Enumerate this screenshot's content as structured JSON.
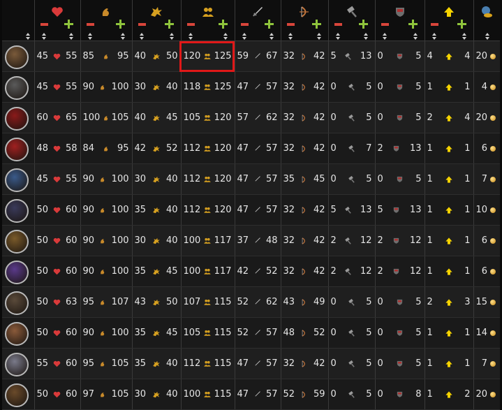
{
  "columns": [
    {
      "key": "portrait",
      "icon": "warrior-portrait-icon"
    },
    {
      "key": "health",
      "icon": "heart-icon",
      "color": "#d93a3a"
    },
    {
      "key": "strength",
      "icon": "arm-icon",
      "color": "#c98a2a"
    },
    {
      "key": "agility",
      "icon": "dragon-icon",
      "color": "#d6a020"
    },
    {
      "key": "leadership",
      "icon": "people-icon",
      "color": "#d6a020"
    },
    {
      "key": "melee",
      "icon": "sword-icon",
      "color": "#bdbdbd"
    },
    {
      "key": "ranged",
      "icon": "bow-icon",
      "color": "#c0733a"
    },
    {
      "key": "armor",
      "icon": "hammer-icon",
      "color": "#9a9a9a"
    },
    {
      "key": "shield",
      "icon": "shield-icon",
      "color": "#b03030"
    },
    {
      "key": "level",
      "icon": "arrow-up-icon",
      "color": "#f5d300"
    },
    {
      "key": "gold",
      "icon": "gold-globe-icon",
      "color": "#d9a21b"
    }
  ],
  "rows": [
    {
      "portrait": "hand-icon",
      "cells": [
        [
          "45",
          "55"
        ],
        [
          "85",
          "95"
        ],
        [
          "40",
          "50"
        ],
        [
          "120",
          "125"
        ],
        [
          "59",
          "67"
        ],
        [
          "32",
          "42"
        ],
        [
          "5",
          "13"
        ],
        [
          "0",
          "5"
        ],
        [
          "4",
          "4"
        ]
      ],
      "gold": "20"
    },
    {
      "portrait": "gauntlet-icon",
      "cells": [
        [
          "45",
          "55"
        ],
        [
          "90",
          "100"
        ],
        [
          "30",
          "40"
        ],
        [
          "118",
          "125"
        ],
        [
          "47",
          "57"
        ],
        [
          "32",
          "42"
        ],
        [
          "0",
          "5"
        ],
        [
          "0",
          "5"
        ],
        [
          "1",
          "1"
        ]
      ],
      "gold": "4"
    },
    {
      "portrait": "red-dragon-icon",
      "cells": [
        [
          "60",
          "65"
        ],
        [
          "100",
          "105"
        ],
        [
          "40",
          "45"
        ],
        [
          "105",
          "120"
        ],
        [
          "57",
          "62"
        ],
        [
          "32",
          "42"
        ],
        [
          "0",
          "5"
        ],
        [
          "0",
          "5"
        ],
        [
          "2",
          "4"
        ]
      ],
      "gold": "20"
    },
    {
      "portrait": "dice-icon",
      "cells": [
        [
          "48",
          "58"
        ],
        [
          "84",
          "95"
        ],
        [
          "42",
          "52"
        ],
        [
          "112",
          "120"
        ],
        [
          "47",
          "57"
        ],
        [
          "32",
          "42"
        ],
        [
          "0",
          "7"
        ],
        [
          "2",
          "13"
        ],
        [
          "1",
          "1"
        ]
      ],
      "gold": "6"
    },
    {
      "portrait": "jester-icon",
      "cells": [
        [
          "45",
          "55"
        ],
        [
          "90",
          "100"
        ],
        [
          "30",
          "40"
        ],
        [
          "112",
          "120"
        ],
        [
          "47",
          "57"
        ],
        [
          "35",
          "45"
        ],
        [
          "0",
          "5"
        ],
        [
          "0",
          "5"
        ],
        [
          "1",
          "1"
        ]
      ],
      "gold": "7"
    },
    {
      "portrait": "mask-icon",
      "cells": [
        [
          "50",
          "60"
        ],
        [
          "90",
          "100"
        ],
        [
          "35",
          "40"
        ],
        [
          "112",
          "120"
        ],
        [
          "47",
          "57"
        ],
        [
          "32",
          "42"
        ],
        [
          "5",
          "13"
        ],
        [
          "5",
          "13"
        ],
        [
          "1",
          "1"
        ]
      ],
      "gold": "10"
    },
    {
      "portrait": "crossbow-icon",
      "cells": [
        [
          "50",
          "60"
        ],
        [
          "90",
          "100"
        ],
        [
          "30",
          "40"
        ],
        [
          "100",
          "117"
        ],
        [
          "37",
          "48"
        ],
        [
          "32",
          "42"
        ],
        [
          "2",
          "12"
        ],
        [
          "2",
          "12"
        ],
        [
          "1",
          "1"
        ]
      ],
      "gold": "6"
    },
    {
      "portrait": "purple-dragon-icon",
      "cells": [
        [
          "50",
          "60"
        ],
        [
          "90",
          "100"
        ],
        [
          "35",
          "45"
        ],
        [
          "100",
          "117"
        ],
        [
          "42",
          "52"
        ],
        [
          "32",
          "42"
        ],
        [
          "2",
          "12"
        ],
        [
          "2",
          "12"
        ],
        [
          "1",
          "1"
        ]
      ],
      "gold": "6"
    },
    {
      "portrait": "beast-icon",
      "cells": [
        [
          "50",
          "63"
        ],
        [
          "95",
          "107"
        ],
        [
          "43",
          "50"
        ],
        [
          "107",
          "115"
        ],
        [
          "52",
          "62"
        ],
        [
          "43",
          "49"
        ],
        [
          "0",
          "5"
        ],
        [
          "0",
          "5"
        ],
        [
          "2",
          "3"
        ]
      ],
      "gold": "15"
    },
    {
      "portrait": "fists-icon",
      "cells": [
        [
          "50",
          "60"
        ],
        [
          "90",
          "100"
        ],
        [
          "35",
          "45"
        ],
        [
          "105",
          "115"
        ],
        [
          "52",
          "57"
        ],
        [
          "48",
          "52"
        ],
        [
          "0",
          "5"
        ],
        [
          "0",
          "5"
        ],
        [
          "1",
          "1"
        ]
      ],
      "gold": "14"
    },
    {
      "portrait": "armored-hand-icon",
      "cells": [
        [
          "55",
          "60"
        ],
        [
          "95",
          "105"
        ],
        [
          "35",
          "40"
        ],
        [
          "112",
          "115"
        ],
        [
          "47",
          "57"
        ],
        [
          "32",
          "42"
        ],
        [
          "0",
          "5"
        ],
        [
          "0",
          "5"
        ],
        [
          "1",
          "1"
        ]
      ],
      "gold": "7"
    },
    {
      "portrait": "minotaur-icon",
      "cells": [
        [
          "50",
          "60"
        ],
        [
          "97",
          "105"
        ],
        [
          "30",
          "40"
        ],
        [
          "100",
          "115"
        ],
        [
          "47",
          "57"
        ],
        [
          "52",
          "59"
        ],
        [
          "0",
          "5"
        ],
        [
          "0",
          "8"
        ],
        [
          "1",
          "2"
        ]
      ],
      "gold": "20"
    }
  ]
}
